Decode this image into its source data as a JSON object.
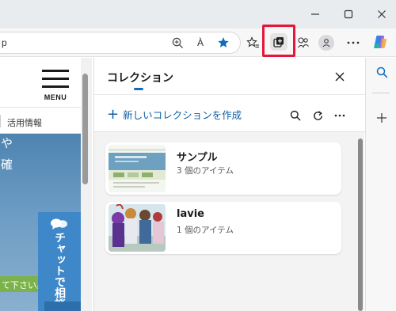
{
  "window": {
    "minimize_icon": "minimize-icon",
    "maximize_icon": "maximize-icon",
    "close_icon": "close-icon"
  },
  "toolbar": {
    "url_fragment": "p",
    "icons": [
      "zoom-icon",
      "read-aloud-icon",
      "favorite-star-icon",
      "favorites-icon",
      "collections-icon",
      "extensions-icon",
      "profile-icon",
      "more-icon",
      "copilot-icon"
    ],
    "read_aloud_label": "À",
    "highlight_color": "#e5163a",
    "star_color": "#0f6cbd"
  },
  "webpage": {
    "menu_label": "MENU",
    "nav_item": "活用情報",
    "hero_line_1": "や",
    "hero_line_2": "確",
    "chat_label": "チャットで相談",
    "green_text": "て下さい。"
  },
  "collections_panel": {
    "title": "コレクション",
    "new_collection_label": "新しいコレクションを作成",
    "accent_color": "#0f6cbd",
    "collections": [
      {
        "name": "サンプル",
        "count": "3 個のアイテム"
      },
      {
        "name": "lavie",
        "count": "1 個のアイテム"
      }
    ]
  },
  "sidebar": {
    "icons": [
      "search-icon",
      "add-icon"
    ]
  }
}
